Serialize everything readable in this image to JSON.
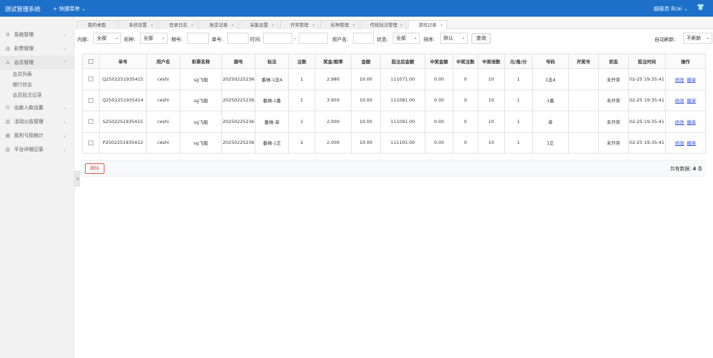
{
  "header": {
    "title": "测试管理系统",
    "quick_menu": "+ 快捷菜单 ⌄",
    "user": "超级员 8cai ⌄",
    "shirt_icon": "👕"
  },
  "sidebar": {
    "items": [
      {
        "icon": "⚙",
        "label": "系统管理",
        "arrow": "⌄"
      },
      {
        "icon": "▤",
        "label": "彩票管理",
        "arrow": "⌄"
      },
      {
        "icon": "♙",
        "label": "会员管理",
        "arrow": "⌃"
      },
      {
        "icon": "☷",
        "label": "出款入款设置",
        "arrow": "⌄"
      },
      {
        "icon": "▥",
        "label": "活动公告管理",
        "arrow": "⌄"
      },
      {
        "icon": "▦",
        "label": "盈利亏损统计",
        "arrow": "⌄"
      },
      {
        "icon": "▥",
        "label": "平台详细记录",
        "arrow": "⌄"
      }
    ],
    "sub_items": [
      "会员列表",
      "银行信息",
      "会员投注记录"
    ]
  },
  "tabs": [
    "我的桌面",
    "系统设置",
    "登录日志",
    "账变记录",
    "采集设置",
    "开奖管理",
    "彩种管理",
    "传统玩法管理",
    "游戏记录"
  ],
  "filter": {
    "inner_label": "内部:",
    "inner_value": "全部",
    "lottery_label": "彩种:",
    "lottery_value": "全部",
    "period_label": "期号:",
    "order_label": "单号:",
    "time_label": "时间:",
    "dash": "-",
    "username_label": "用户名:",
    "status_label": "状态:",
    "status_value": "全部",
    "sort_label": "排序:",
    "sort_value": "默认",
    "query_button": "查询",
    "auto_refresh_label": "自动刷新:",
    "auto_refresh_value": "不刷新",
    "caret": "⌄"
  },
  "table": {
    "headers": [
      "单号",
      "用户名",
      "彩票名称",
      "期号",
      "玩法",
      "注数",
      "奖金/赔率",
      "金额",
      "投注后金额",
      "中奖金额",
      "中奖注数",
      "中奖倍数",
      "元/角/分",
      "号码",
      "开奖号",
      "状态",
      "投注时间",
      "操作"
    ],
    "rows": [
      {
        "order": "Q2502251935415",
        "user": "ceshi",
        "lottery": "sg飞艇",
        "period": "20250225236",
        "play": "番摊-1念4",
        "bets": "1",
        "odds": "2.980",
        "amount": "10.00",
        "balance": "111071.00",
        "win": "0.00",
        "win_bets": "0",
        "multiple": "10",
        "unit": "1",
        "number": "1念4",
        "draw": "",
        "status": "未开奖",
        "time": "02-25 19:35:41"
      },
      {
        "order": "Q2502251935414",
        "user": "ceshi",
        "lottery": "sg飞艇",
        "period": "20250225236",
        "play": "番摊-1番",
        "bets": "1",
        "odds": "3.950",
        "amount": "10.00",
        "balance": "111081.00",
        "win": "0.00",
        "win_bets": "0",
        "multiple": "10",
        "unit": "1",
        "number": "1番",
        "draw": "",
        "status": "未开奖",
        "time": "02-25 19:35:41"
      },
      {
        "order": "S2502251935415",
        "user": "ceshi",
        "lottery": "sg飞艇",
        "period": "20250225236",
        "play": "番摊-单",
        "bets": "1",
        "odds": "2.000",
        "amount": "10.00",
        "balance": "111091.00",
        "win": "0.00",
        "win_bets": "0",
        "multiple": "10",
        "unit": "1",
        "number": "单",
        "draw": "",
        "status": "未开奖",
        "time": "02-25 19:35:41"
      },
      {
        "order": "P2502251935412",
        "user": "ceshi",
        "lottery": "sg飞艇",
        "period": "20250225236",
        "play": "番摊-1正",
        "bets": "1",
        "odds": "2.000",
        "amount": "10.00",
        "balance": "111101.00",
        "win": "0.00",
        "win_bets": "0",
        "multiple": "10",
        "unit": "1",
        "number": "1正",
        "draw": "",
        "status": "未开奖",
        "time": "02-25 19:35:41"
      }
    ],
    "edit_label": "修改",
    "cancel_label": "撤单"
  },
  "footer": {
    "delete_button": "删除",
    "total_prefix": "共有数据:",
    "total_count": "4",
    "total_suffix": "条"
  },
  "colors": {
    "header_bg": "#1e6fc9",
    "link": "#2b4fd6",
    "delete": "#d9534f"
  }
}
